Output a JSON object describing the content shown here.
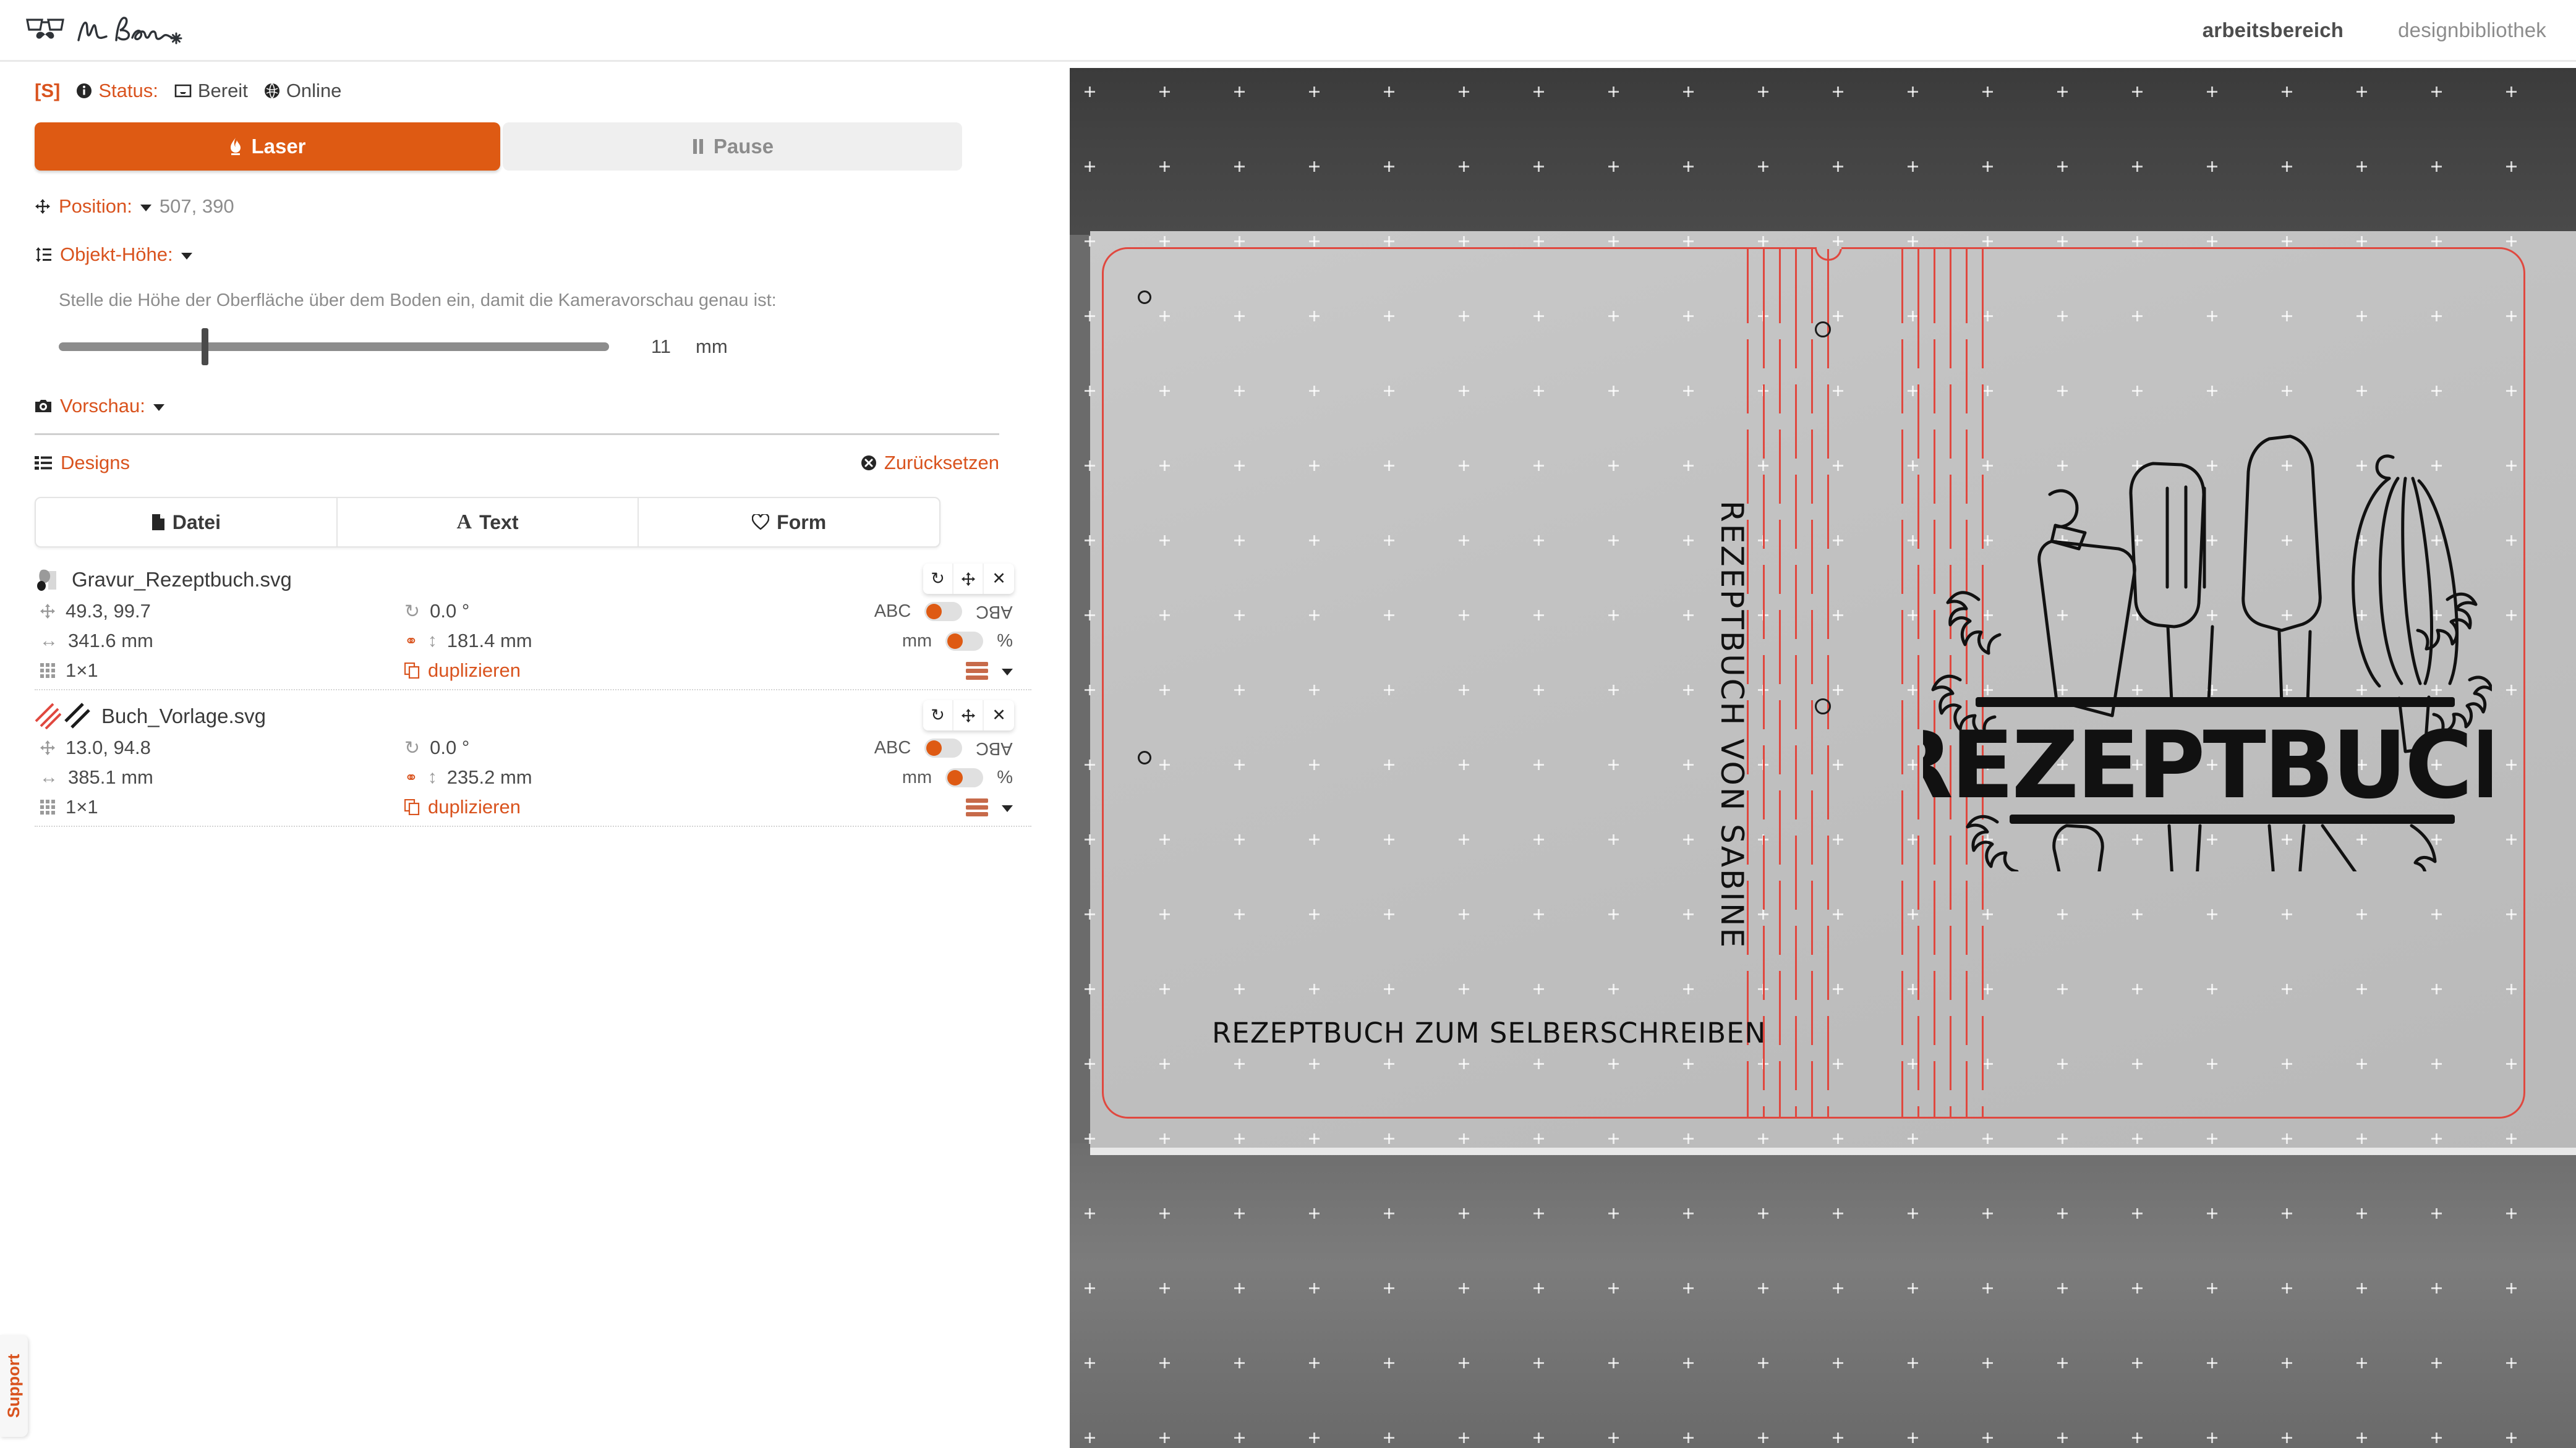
{
  "header": {
    "brand_name": "Mr Beam",
    "nav": [
      {
        "label": "arbeitsbereich",
        "active": true
      },
      {
        "label": "designbibliothek",
        "active": false
      }
    ]
  },
  "status": {
    "bracket": "[S]",
    "label": "Status:",
    "state": "Bereit",
    "connection": "Online"
  },
  "actions": {
    "laser_label": "Laser",
    "pause_label": "Pause"
  },
  "position": {
    "label": "Position:",
    "value": "507, 390"
  },
  "object_height": {
    "label": "Objekt-Höhe:",
    "hint": "Stelle die Höhe der Oberfläche über dem Boden ein, damit die Kameravorschau genau ist:",
    "value": "11",
    "unit": "mm",
    "slider_percent": 26
  },
  "preview": {
    "label": "Vorschau:"
  },
  "designs_panel": {
    "title": "Designs",
    "reset_label": "Zurücksetzen",
    "tabs": [
      {
        "label": "Datei",
        "icon": "file-icon"
      },
      {
        "label": "Text",
        "icon": "text-icon"
      },
      {
        "label": "Form",
        "icon": "shape-heart-icon"
      }
    ]
  },
  "designs": [
    {
      "filename": "Gravur_Rezeptbuch.svg",
      "thumb_type": "image",
      "position": "49.3, 99.7",
      "rotation": "0.0 °",
      "width": "341.6 mm",
      "height": "181.4 mm",
      "multiply": "1×1",
      "duplicate_label": "duplizieren",
      "toggle_text_left": "ABC",
      "toggle_text_right": "ABC",
      "toggle_unit_left": "mm",
      "toggle_unit_right": "%"
    },
    {
      "filename": "Buch_Vorlage.svg",
      "thumb_type": "stripes",
      "position": "13.0, 94.8",
      "rotation": "0.0 °",
      "width": "385.1 mm",
      "height": "235.2 mm",
      "multiply": "1×1",
      "duplicate_label": "duplizieren",
      "toggle_text_left": "ABC",
      "toggle_text_right": "ABC",
      "toggle_unit_left": "mm",
      "toggle_unit_right": "%"
    }
  ],
  "support": {
    "label": "Support"
  },
  "workspace": {
    "engraving_title": "REZEPTBUCH",
    "spine_text": "REZEPTBUCH VON SABINE",
    "bottom_text": "REZEPTBUCH ZUM SELBERSCHREIBEN"
  },
  "colors": {
    "accent": "#d9531e",
    "laser_button": "#de5a13",
    "cut_line": "#e0483f",
    "muted_text": "#8c8c8c"
  }
}
